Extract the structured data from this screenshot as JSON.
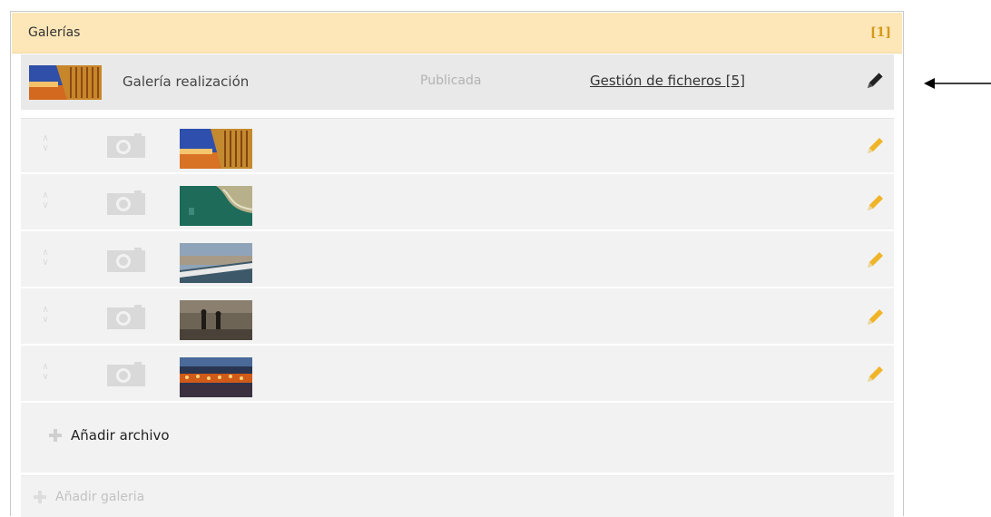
{
  "header": {
    "title": "Galerías",
    "count": "[1]"
  },
  "gallery": {
    "name": "Galería realización",
    "status": "Publicada",
    "files_link": "Gestión de ficheros [5]",
    "edit_icon": "pencil-icon"
  },
  "files": [
    {
      "id": 1,
      "thumb": "building-facade-sunset",
      "edit_icon": "pencil-icon"
    },
    {
      "id": 2,
      "thumb": "aerial-coast",
      "edit_icon": "pencil-icon"
    },
    {
      "id": 3,
      "thumb": "waterfront-walkway",
      "edit_icon": "pencil-icon"
    },
    {
      "id": 4,
      "thumb": "people-walking-wall",
      "edit_icon": "pencil-icon"
    },
    {
      "id": 5,
      "thumb": "night-lights",
      "edit_icon": "pencil-icon"
    }
  ],
  "actions": {
    "add_file": "Añadir archivo",
    "add_gallery": "Añadir galeria"
  },
  "colors": {
    "header_bg": "#fde7b8",
    "count": "#d59a1a",
    "pencil": "#f0b429",
    "gallery_bg": "#e9e9e9",
    "files_bg": "#f2f2f2"
  }
}
